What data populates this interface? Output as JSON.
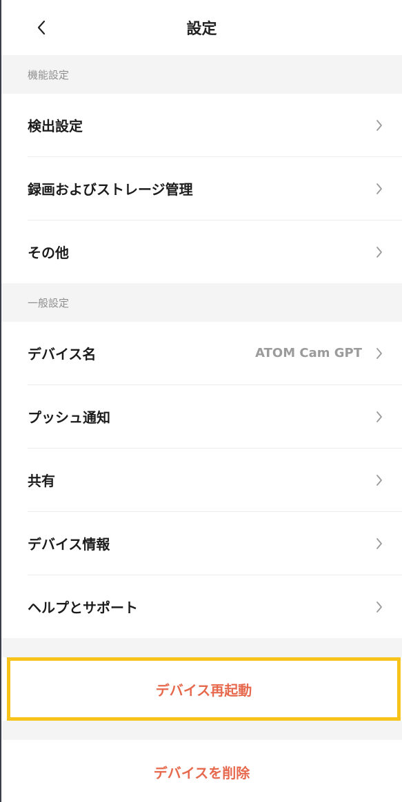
{
  "header": {
    "title": "設定",
    "back_icon": "chevron-left-icon"
  },
  "sections": {
    "function_settings": {
      "title": "機能設定",
      "items": [
        {
          "label": "検出設定"
        },
        {
          "label": "録画およびストレージ管理"
        },
        {
          "label": "その他"
        }
      ]
    },
    "general_settings": {
      "title": "一般設定",
      "items": [
        {
          "label": "デバイス名",
          "value": "ATOM Cam GPT"
        },
        {
          "label": "プッシュ通知"
        },
        {
          "label": "共有"
        },
        {
          "label": "デバイス情報"
        },
        {
          "label": "ヘルプとサポート"
        }
      ]
    }
  },
  "actions": {
    "restart_label": "デバイス再起動",
    "delete_label": "デバイスを削除"
  },
  "colors": {
    "accent_text": "#e7694d",
    "highlight_border": "#f7c21a",
    "section_bg": "#f4f4f4"
  }
}
